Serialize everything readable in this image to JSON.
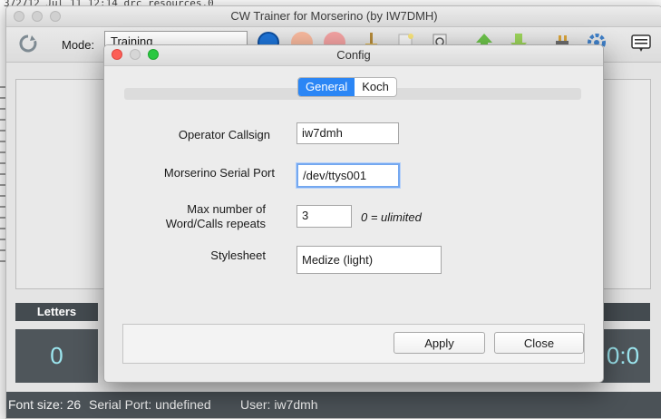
{
  "terminal": {
    "top_line": "372712 Jul 11 12:14 drc resources.0"
  },
  "main_window": {
    "title": "CW Trainer for Morserino (by IW7DMH)",
    "toolbar": {
      "mode_label": "Mode:",
      "mode_value": "Training",
      "icons": [
        "reset-icon",
        "play-icon",
        "pause-icon",
        "stop-icon",
        "broom-icon",
        "new-file-icon",
        "document-search-icon",
        "up-arrow-icon",
        "down-arrow-icon",
        "plug-icon",
        "settings-gear-icon",
        "keyboard-icon"
      ]
    },
    "stats": {
      "letters_label": "Letters",
      "letters_value": "0",
      "right_value": "0:0"
    },
    "statusbar": {
      "font_size": "Font size: 26",
      "serial_port": "Serial Port: undefined",
      "user": "User: iw7dmh"
    }
  },
  "dialog": {
    "title": "Config",
    "tabs": [
      {
        "label": "General",
        "active": true
      },
      {
        "label": "Koch",
        "active": false
      }
    ],
    "fields": {
      "callsign_label": "Operator Callsign",
      "callsign_value": "iw7dmh",
      "serial_label": "Morserino Serial Port",
      "serial_value": "/dev/ttys001",
      "repeats_label_1": "Max number of",
      "repeats_label_2": "Word/Calls repeats",
      "repeats_value": "3",
      "repeats_hint": "0 = ulimited",
      "stylesheet_label": "Stylesheet",
      "stylesheet_value": "Medize (light)"
    },
    "buttons": {
      "apply": "Apply",
      "close": "Close"
    }
  },
  "colors": {
    "accent_tab": "#2b86f5",
    "status_bar": "#4b5257",
    "stat_value": "#9ce6ef"
  }
}
